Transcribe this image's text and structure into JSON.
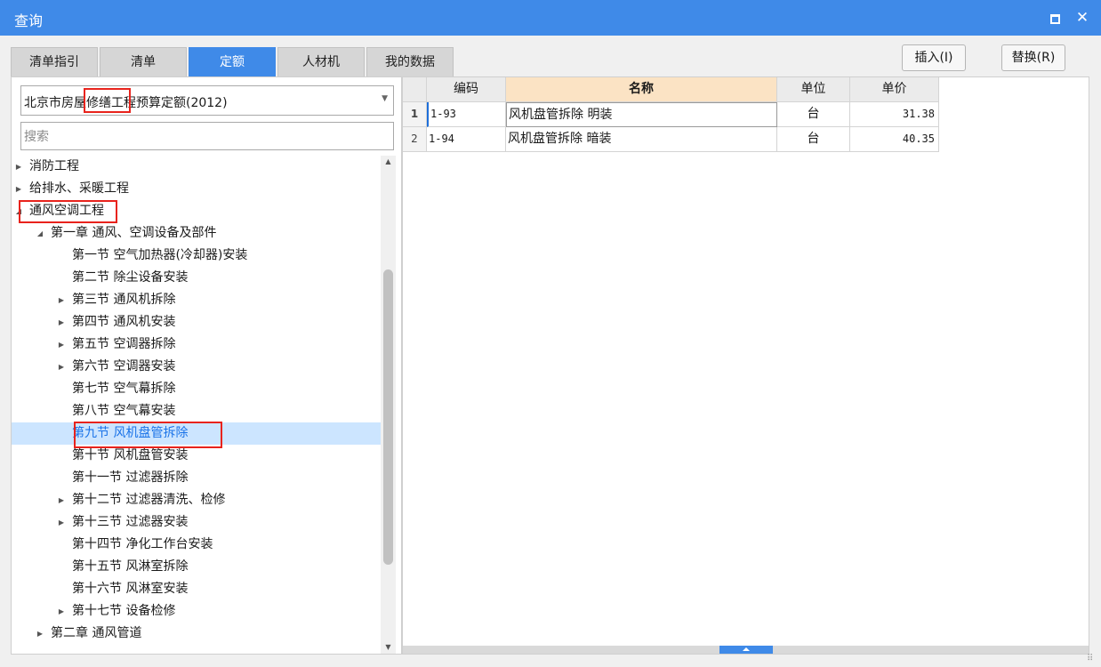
{
  "window": {
    "title": "查询",
    "maximize_icon": "maximize-icon",
    "close_icon": "close-icon",
    "close_glyph": "✕"
  },
  "tabs": [
    {
      "label": "清单指引",
      "active": false
    },
    {
      "label": "清单",
      "active": false
    },
    {
      "label": "定额",
      "active": true
    },
    {
      "label": "人材机",
      "active": false
    },
    {
      "label": "我的数据",
      "active": false
    }
  ],
  "actions": {
    "insert_label": "插入(I)",
    "replace_label": "替换(R)"
  },
  "library": {
    "selected": "北京市房屋修缮工程预算定额(2012)"
  },
  "search": {
    "placeholder": "搜索",
    "value": ""
  },
  "tree": [
    {
      "label": "消防工程",
      "level": 0,
      "expander": "collapsed"
    },
    {
      "label": "给排水、采暖工程",
      "level": 0,
      "expander": "collapsed"
    },
    {
      "label": "通风空调工程",
      "level": 0,
      "expander": "expanded"
    },
    {
      "label": "第一章 通风、空调设备及部件",
      "level": 1,
      "expander": "expanded"
    },
    {
      "label": "第一节 空气加热器(冷却器)安装",
      "level": 2,
      "expander": "none"
    },
    {
      "label": "第二节 除尘设备安装",
      "level": 2,
      "expander": "none"
    },
    {
      "label": "第三节 通风机拆除",
      "level": 2,
      "expander": "collapsed"
    },
    {
      "label": "第四节 通风机安装",
      "level": 2,
      "expander": "collapsed"
    },
    {
      "label": "第五节 空调器拆除",
      "level": 2,
      "expander": "collapsed"
    },
    {
      "label": "第六节 空调器安装",
      "level": 2,
      "expander": "collapsed"
    },
    {
      "label": "第七节 空气幕拆除",
      "level": 2,
      "expander": "none"
    },
    {
      "label": "第八节 空气幕安装",
      "level": 2,
      "expander": "none"
    },
    {
      "label": "第九节 风机盘管拆除",
      "level": 2,
      "expander": "none",
      "selected": true
    },
    {
      "label": "第十节 风机盘管安装",
      "level": 2,
      "expander": "none"
    },
    {
      "label": "第十一节 过滤器拆除",
      "level": 2,
      "expander": "none"
    },
    {
      "label": "第十二节 过滤器清洗、检修",
      "level": 2,
      "expander": "collapsed"
    },
    {
      "label": "第十三节 过滤器安装",
      "level": 2,
      "expander": "collapsed"
    },
    {
      "label": "第十四节 净化工作台安装",
      "level": 2,
      "expander": "none"
    },
    {
      "label": "第十五节 风淋室拆除",
      "level": 2,
      "expander": "none"
    },
    {
      "label": "第十六节 风淋室安装",
      "level": 2,
      "expander": "none"
    },
    {
      "label": "第十七节 设备检修",
      "level": 2,
      "expander": "collapsed"
    },
    {
      "label": "第二章 通风管道",
      "level": 1,
      "expander": "collapsed"
    }
  ],
  "table": {
    "columns": [
      "编码",
      "名称",
      "单位",
      "单价"
    ],
    "rows": [
      {
        "num": "1",
        "code": "1-93",
        "name": "风机盘管拆除 明装",
        "unit": "台",
        "price": "31.38"
      },
      {
        "num": "2",
        "code": "1-94",
        "name": "风机盘管拆除 暗装",
        "unit": "台",
        "price": "40.35"
      }
    ]
  },
  "colors": {
    "accent": "#3f8ae8",
    "header_highlight": "#fbe3c4",
    "selection": "#cce5ff",
    "annotation": "#e8231c"
  },
  "icons": {
    "collapsed": "▶",
    "expanded": "◢",
    "scroll_up": "▲",
    "scroll_down": "▼",
    "dropdown": "▼",
    "resize_grip": "⠿"
  }
}
